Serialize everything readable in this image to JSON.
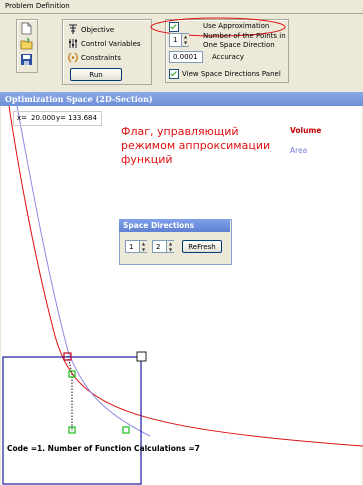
{
  "problem_definition": {
    "title": "Problem Definition",
    "options": [
      "Objective",
      "Control Variables",
      "Constraints"
    ],
    "run_label": "Run",
    "use_approximation": {
      "label": "Use Approximation",
      "checked": true
    },
    "points_per_direction": {
      "value": "1",
      "label_line1": "Number of the Points in",
      "label_line2": "One Space Direction"
    },
    "accuracy": {
      "value": "0.0001",
      "label": "Accuracy"
    },
    "view_space_directions": {
      "label": "View Space Directions Panel",
      "checked": true
    }
  },
  "optimization_space": {
    "title": "Optimization Space (2D-Section)",
    "x_label": "x=",
    "x_value": "20.000",
    "y_label": "y=",
    "y_value": "133.684",
    "annotation_lines": [
      "Флаг, управляющий",
      "режимом аппроксимации",
      "функций"
    ],
    "legend": [
      {
        "name": "Volume",
        "color": "#c00000"
      },
      {
        "name": "Area",
        "color": "#7b7bde"
      }
    ],
    "status": "Code =1.   Number of Function Calculations =7"
  },
  "space_directions": {
    "title": "Space Directions",
    "dir1": "1",
    "dir2": "2",
    "refresh_label": "ReFresh"
  },
  "colors": {
    "annotation": "#e01010",
    "selection": "#1a1aa0",
    "point": "#18c018"
  }
}
